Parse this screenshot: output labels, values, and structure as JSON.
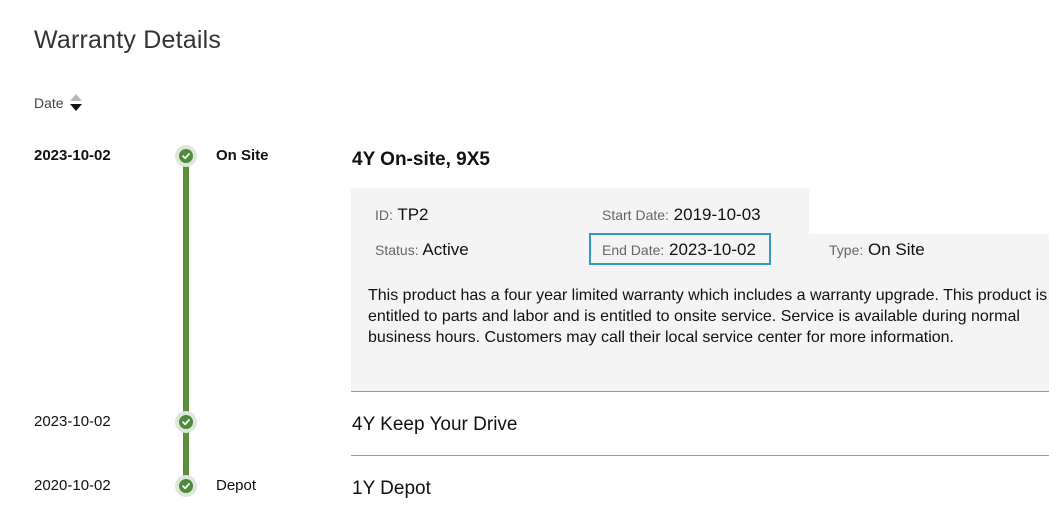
{
  "page": {
    "title": "Warranty Details"
  },
  "sort": {
    "label": "Date"
  },
  "warranties": [
    {
      "date": "2023-10-02",
      "type": "On Site",
      "name": "4Y On-site, 9X5",
      "details": {
        "id_label": "ID:",
        "id_value": "TP2",
        "start_label": "Start Date:",
        "start_value": "2019-10-03",
        "status_label": "Status:",
        "status_value": "Active",
        "end_label": "End Date:",
        "end_value": "2023-10-02",
        "type_label": "Type:",
        "type_value": "On Site",
        "description": "This product has a four year limited warranty which includes a warranty upgrade. This product is entitled to parts and labor and is entitled to onsite service. Service is available during normal business hours. Customers may call their local service center for more information."
      }
    },
    {
      "date": "2023-10-02",
      "type": "",
      "name": "4Y Keep Your Drive"
    },
    {
      "date": "2020-10-02",
      "type": "Depot",
      "name": "1Y Depot"
    }
  ],
  "colors": {
    "timeline": "#5c8f3c",
    "highlight_border": "#2f9bc3",
    "panel_bg": "#f4f4f4"
  },
  "icons": {
    "node": "check-circle-icon",
    "sort": "sort-arrows-icon"
  }
}
